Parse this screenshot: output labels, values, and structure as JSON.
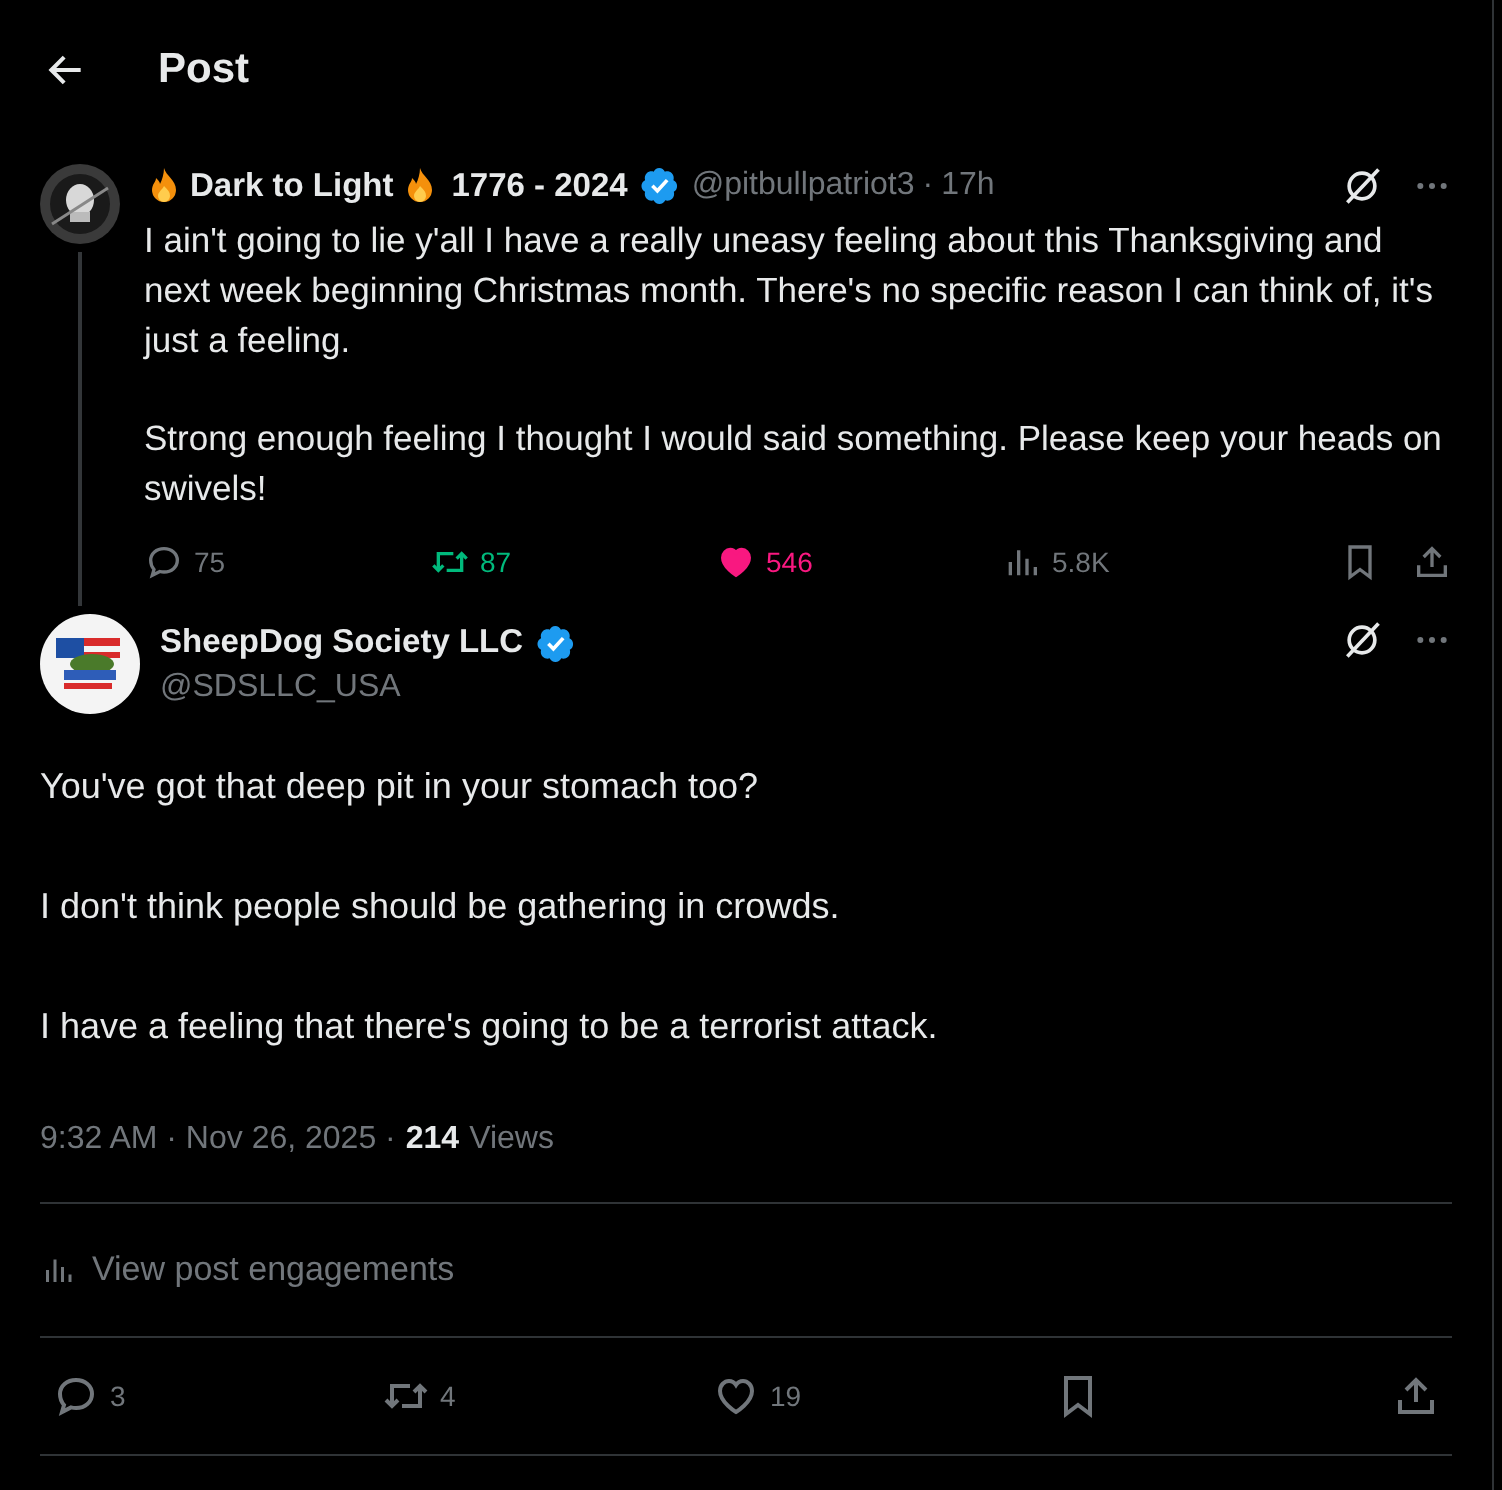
{
  "header": {
    "title": "Post"
  },
  "parent_post": {
    "name": "Dark to Light",
    "name_suffix": "1776 - 2024",
    "verified": true,
    "handle": "@pitbullpatriot3",
    "separator": "·",
    "time": "17h",
    "paragraphs": [
      "I ain't going to lie y'all I have a really uneasy feeling about this Thanksgiving and next week beginning Christmas month. There's no specific reason I can think of, it's just a feeling.",
      "Strong enough feeling I thought I would said something. Please keep your heads on swivels!"
    ],
    "stats": {
      "replies": "75",
      "reposts": "87",
      "reposted": true,
      "likes": "546",
      "liked": true,
      "views": "5.8K"
    }
  },
  "post": {
    "name": "SheepDog Society LLC",
    "verified": true,
    "handle": "@SDSLLC_USA",
    "paragraphs": [
      "You've got that deep pit in your stomach too?",
      "I don't think people should be gathering in crowds.",
      "I have a feeling that there's going to be a terrorist attack."
    ],
    "timestamp": "9:32 AM · Nov 26, 2025 ·",
    "views_count": "214",
    "views_label": "Views",
    "engagements": "View post engagements",
    "stats": {
      "replies": "3",
      "reposts": "4",
      "reposted": false,
      "likes": "19",
      "liked": false
    }
  }
}
